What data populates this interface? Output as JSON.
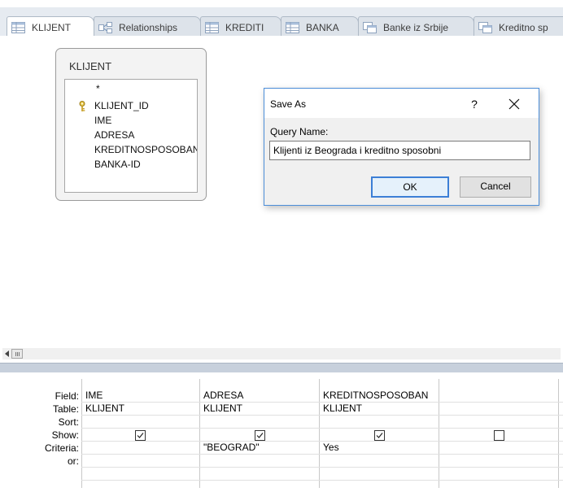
{
  "tabs": [
    {
      "label": "KLIJENT",
      "icon": "table-icon",
      "active": true
    },
    {
      "label": "Relationships",
      "icon": "relationships-icon",
      "active": false
    },
    {
      "label": "KREDITI",
      "icon": "table-icon",
      "active": false
    },
    {
      "label": "BANKA",
      "icon": "table-icon",
      "active": false
    },
    {
      "label": "Banke iz Srbije",
      "icon": "query-icon",
      "active": false
    },
    {
      "label": "Kreditno sp",
      "icon": "query-icon",
      "active": false
    }
  ],
  "table_box": {
    "title": "KLIJENT",
    "fields": [
      "*",
      "KLIJENT_ID",
      "IME",
      "ADRESA",
      "KREDITNOSPOSOBAN",
      "BANKA-ID"
    ],
    "primary_key": "KLIJENT_ID"
  },
  "dialog": {
    "title": "Save As",
    "help": "?",
    "query_label": "Query Name:",
    "query_value": "Klijenti iz Beograda i kreditno sposobni",
    "ok": "OK",
    "cancel": "Cancel"
  },
  "grid": {
    "row_labels": [
      "Field:",
      "Table:",
      "Sort:",
      "Show:",
      "Criteria:",
      "or:"
    ],
    "columns": [
      {
        "field": "IME",
        "table": "KLIJENT",
        "sort": "",
        "show": true,
        "criteria": "",
        "or": ""
      },
      {
        "field": "ADRESA",
        "table": "KLIJENT",
        "sort": "",
        "show": true,
        "criteria": "\"BEOGRAD\"",
        "or": ""
      },
      {
        "field": "KREDITNOSPOSOBAN",
        "table": "KLIJENT",
        "sort": "",
        "show": true,
        "criteria": "Yes",
        "or": ""
      },
      {
        "field": "",
        "table": "",
        "sort": "",
        "show": false,
        "criteria": "",
        "or": ""
      }
    ]
  }
}
